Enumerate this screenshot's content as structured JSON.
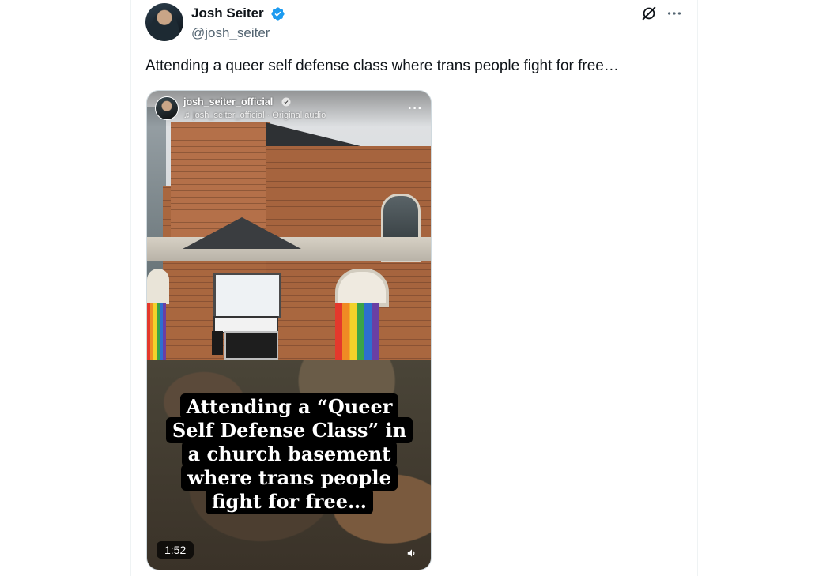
{
  "author": {
    "display_name": "Josh Seiter",
    "handle": "@josh_seiter",
    "verified": true
  },
  "tweet": {
    "text": "Attending a queer self defense class where trans people fight for free…"
  },
  "media": {
    "overlay_user": "josh_seiter_official",
    "overlay_audio": "josh_seiter_official · Original audio",
    "caption_lines": [
      "Attending a “Queer",
      "Self Defense Class” in",
      "a church basement",
      "where trans people",
      "fight for free…"
    ],
    "duration": "1:52"
  },
  "icons": {
    "verified": "verified-badge-icon",
    "grok": "grok-icon",
    "more": "more-icon",
    "music": "music-note-icon",
    "volume": "volume-icon"
  },
  "colors": {
    "verified_blue": "#1d9bf0",
    "text_primary": "#0f1419",
    "text_secondary": "#536471"
  }
}
